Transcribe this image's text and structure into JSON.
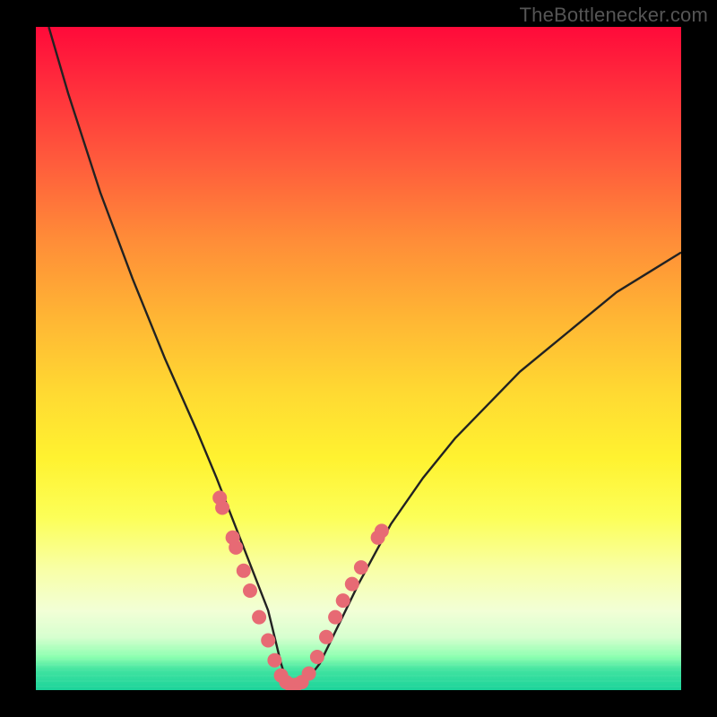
{
  "attribution": "TheBottlenecker.com",
  "colors": {
    "curve": "#222222",
    "marker": "#e76a74",
    "gradient_top": "#ff0a3a",
    "gradient_bottom": "#1bd39a"
  },
  "chart_data": {
    "type": "line",
    "title": "",
    "xlabel": "",
    "ylabel": "",
    "xlim": [
      0,
      100
    ],
    "ylim": [
      0,
      100
    ],
    "notes": "V-shaped bottleneck curve over a vertical heatmap gradient (red at top = high bottleneck, green at bottom = no bottleneck). Axes are unlabeled. Values estimated from pixel positions.",
    "series": [
      {
        "name": "bottleneck-curve",
        "x": [
          2,
          5,
          10,
          15,
          20,
          25,
          28,
          30,
          32,
          34,
          36,
          37,
          38,
          38.8,
          39.5,
          40.5,
          42,
          44,
          46,
          48,
          50,
          55,
          60,
          65,
          70,
          75,
          80,
          85,
          90,
          95,
          100
        ],
        "y": [
          100,
          90,
          75,
          62,
          50,
          39,
          32,
          27,
          22,
          17,
          12,
          8,
          4,
          1.5,
          0.5,
          0.5,
          1.5,
          4,
          8,
          12,
          16,
          25,
          32,
          38,
          43,
          48,
          52,
          56,
          60,
          63,
          66
        ]
      }
    ],
    "markers": [
      {
        "x": 28.5,
        "y": 29
      },
      {
        "x": 28.9,
        "y": 27.5
      },
      {
        "x": 30.5,
        "y": 23
      },
      {
        "x": 31.0,
        "y": 21.5
      },
      {
        "x": 32.2,
        "y": 18
      },
      {
        "x": 33.2,
        "y": 15
      },
      {
        "x": 34.6,
        "y": 11
      },
      {
        "x": 36.0,
        "y": 7.5
      },
      {
        "x": 37.0,
        "y": 4.5
      },
      {
        "x": 38.0,
        "y": 2.2
      },
      {
        "x": 38.8,
        "y": 1.2
      },
      {
        "x": 39.5,
        "y": 0.8
      },
      {
        "x": 40.3,
        "y": 0.8
      },
      {
        "x": 41.2,
        "y": 1.2
      },
      {
        "x": 42.3,
        "y": 2.5
      },
      {
        "x": 43.6,
        "y": 5
      },
      {
        "x": 45.0,
        "y": 8
      },
      {
        "x": 46.4,
        "y": 11
      },
      {
        "x": 47.6,
        "y": 13.5
      },
      {
        "x": 49.0,
        "y": 16
      },
      {
        "x": 50.4,
        "y": 18.5
      },
      {
        "x": 53.0,
        "y": 23
      },
      {
        "x": 53.6,
        "y": 24
      }
    ]
  }
}
